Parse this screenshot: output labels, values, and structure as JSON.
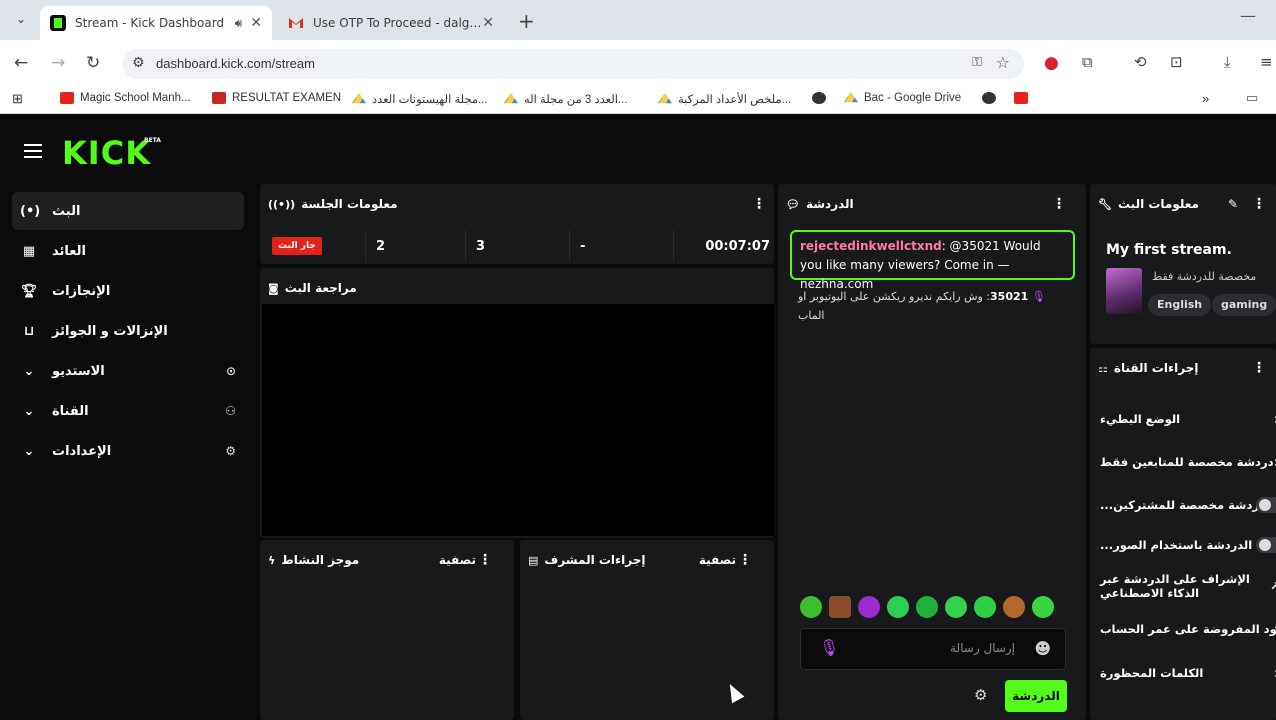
{
  "browser": {
    "tabs": [
      {
        "title": "Stream - Kick Dashboard",
        "active": true
      },
      {
        "title": "Use OTP To Proceed - dalgerie",
        "active": false
      }
    ],
    "url": "dashboard.kick.com/stream",
    "bookmarks": [
      {
        "label": "Magic School Manh...",
        "icon": "youtube-icon"
      },
      {
        "label": "RESULTAT EXAMEN",
        "icon": "onec-icon"
      },
      {
        "label": "مجلة الهيستونات العدد...",
        "icon": "drive-icon"
      },
      {
        "label": "العدد 3 من مجلة اله...",
        "icon": "drive-icon"
      },
      {
        "label": "ملخص الأعداد المركبة...",
        "icon": "drive-icon"
      },
      {
        "label": "",
        "icon": "globe-icon"
      },
      {
        "label": "Bac - Google Drive",
        "icon": "drive-icon"
      },
      {
        "label": "",
        "icon": "globe-icon"
      },
      {
        "label": "",
        "icon": "youtube-icon"
      }
    ]
  },
  "app": {
    "logo": "KICK",
    "beta": "BETA",
    "sidebar": [
      {
        "label": "البث",
        "icon": "broadcast-icon",
        "active": true
      },
      {
        "label": "العائد",
        "icon": "chart-icon"
      },
      {
        "label": "الإنجازات",
        "icon": "trophy-icon"
      },
      {
        "label": "الإنزالات و الجوائز",
        "icon": "drops-icon"
      },
      {
        "label": "الاستديو",
        "icon": "studio-icon"
      },
      {
        "label": "القناة",
        "icon": "channel-icon"
      },
      {
        "label": "الإعدادات",
        "icon": "settings-icon"
      }
    ],
    "session": {
      "title": "معلومات الجلسة",
      "live_badge": "جار البث",
      "stat1": "2",
      "stat2": "3",
      "stat3": "-",
      "uptime": "00:07:07"
    },
    "preview": {
      "title": "مراجعة البث"
    },
    "activity": {
      "title": "موجز النشاط",
      "filter": "تصفية"
    },
    "modactions": {
      "title": "إجراءات المشرف",
      "filter": "تصفية"
    },
    "chat": {
      "title": "الدردشة",
      "messages": [
        {
          "user": "rejectedinkwellctxnd",
          "text": ": @35021 Would you like many viewers? Come in — nezhna.com"
        },
        {
          "user": "35021",
          "text": "وش رايكم نديرو ريكشن على اليوتيوبر او الماب"
        }
      ],
      "placeholder": "إرسال رسالة",
      "send_label": "الدردشة"
    },
    "stream_info": {
      "title": "معلومات البث",
      "stream_title": "My first stream.",
      "subtitle": "مخصصة للدردشة فقط",
      "tags": [
        "English",
        "gaming"
      ]
    },
    "channel_actions": {
      "title": "إجراءات القناة",
      "items": [
        {
          "label": "الوضع البطيء",
          "type": "chevron"
        },
        {
          "label": "دردشة مخصصة للمتابعين فقط",
          "type": "chevron"
        },
        {
          "label": "...الدردشة مخصصة للمشتركين",
          "type": "toggle"
        },
        {
          "label": "...الدردشة باستخدام الصور",
          "type": "toggle"
        },
        {
          "label": "الإشراف على الدردشة عبر الذكاء الاصطناعي",
          "type": "external"
        },
        {
          "label": "قيود المفروضة على عمر الحساب",
          "type": "chevron"
        },
        {
          "label": "الكلمات المحظورة",
          "type": "chevron"
        }
      ]
    },
    "colors": {
      "accent": "#53fc18",
      "live": "#e1241b",
      "panel": "#18191b",
      "bg": "#0b0b0c"
    }
  }
}
